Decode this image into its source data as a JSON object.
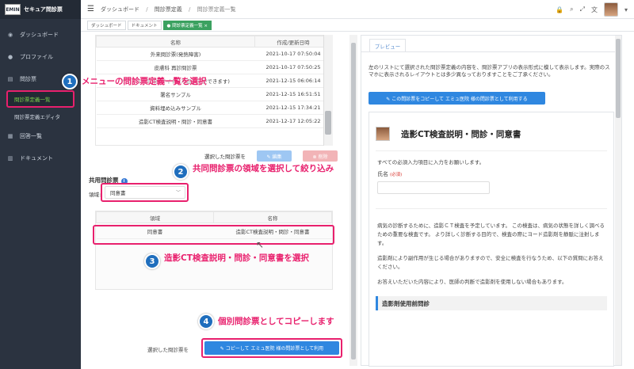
{
  "sidebar": {
    "logo_text": "EMIN",
    "brand_title": "セキュア問診票",
    "items": [
      {
        "label": "ダッシュボード"
      },
      {
        "label": "プロファイル"
      },
      {
        "label": "問診票"
      },
      {
        "label": "回答一覧"
      },
      {
        "label": "ドキュメント"
      }
    ],
    "sub_items": [
      {
        "label": "問診票定義一覧"
      },
      {
        "label": "問診票定義エディタ"
      }
    ]
  },
  "breadcrumb": {
    "items": [
      "ダッシュボード",
      "問診票定義",
      "問診票定義一覧"
    ]
  },
  "tabs": [
    {
      "label": "ダッシュボード"
    },
    {
      "label": "ドキュメント"
    },
    {
      "label": "● 問診票定義一覧 ×"
    }
  ],
  "table1": {
    "headers": [
      "名称",
      "作成/更新日時"
    ],
    "rows": [
      {
        "name": "外来問診票(発熱障害)",
        "date": "2021-10-17 07:50:04"
      },
      {
        "name": "皮膚科 再診問診票",
        "date": "2021-10-17 07:50:25"
      },
      {
        "name": "サンプル問診票 (タイトル項目に変更できます)",
        "date": "2021-12-15 06:06:14"
      },
      {
        "name": "署名サンプル",
        "date": "2021-12-15 16:51:51"
      },
      {
        "name": "資料埋め込みサンプル",
        "date": "2021-12-15 17:34:21"
      },
      {
        "name": "造影CT検査説明・問診・同意書",
        "date": "2021-12-17 12:05:22"
      }
    ]
  },
  "selected_label_1": "選択した問診票を",
  "buttons": {
    "edit": "✎ 編集",
    "delete": "⊗ 削除",
    "copy": "✎ コピーして エミュ医院 様の問診票として利用"
  },
  "shared": {
    "title": "共用問診票",
    "area_label": "領域:",
    "area_value": "同意書"
  },
  "table2": {
    "headers": [
      "領域",
      "名称"
    ],
    "rows": [
      {
        "area": "同意書",
        "name": "造影CT検査説明・問診・同意書"
      }
    ]
  },
  "selected_label_2": "選択した問診票を",
  "callouts": [
    {
      "num": "1",
      "text": "メニューの問診票定義一覧を選択"
    },
    {
      "num": "2",
      "text": "共同問診票の領域を選択して絞り込み"
    },
    {
      "num": "3",
      "text": "造影CT検査説明・問診・同意書を選択"
    },
    {
      "num": "4",
      "text": "個別問診票としてコピーします"
    }
  ],
  "preview": {
    "tab": "プレビュー",
    "desc": "左のリストにて選択された問診票定義の内容を、問診票アプリの表示形式に模して表示します。実際のスマホに表示されるレイアウトとは多少異なっておりますことをご了承ください。",
    "button": "✎ この問診票をコピーして エミュ医院 様の問診票として利用する",
    "form_title": "造影CT検査説明・問診・同意書",
    "required_note": "すべての必須入力項目に入力をお願いします。",
    "name_label": "氏名",
    "required_badge": "(必須)",
    "para1": "病気の診断するために、造影ＣＴ検査を予定しています。 この検査は、病気の状態を詳しく調べるための重要な検査です。 より詳しく診断する目的で、検査の際にヨード造影剤を静脈に注射します。",
    "para2": "造影剤により副作用が生じる場合がありますので、安全に検査を行なうため、以下の質問にお答えください。",
    "para3": "お答えいただいた内容により、医師の判断で造影剤を使用しない場合もあります。",
    "section_title": "造影剤使用前問診"
  }
}
